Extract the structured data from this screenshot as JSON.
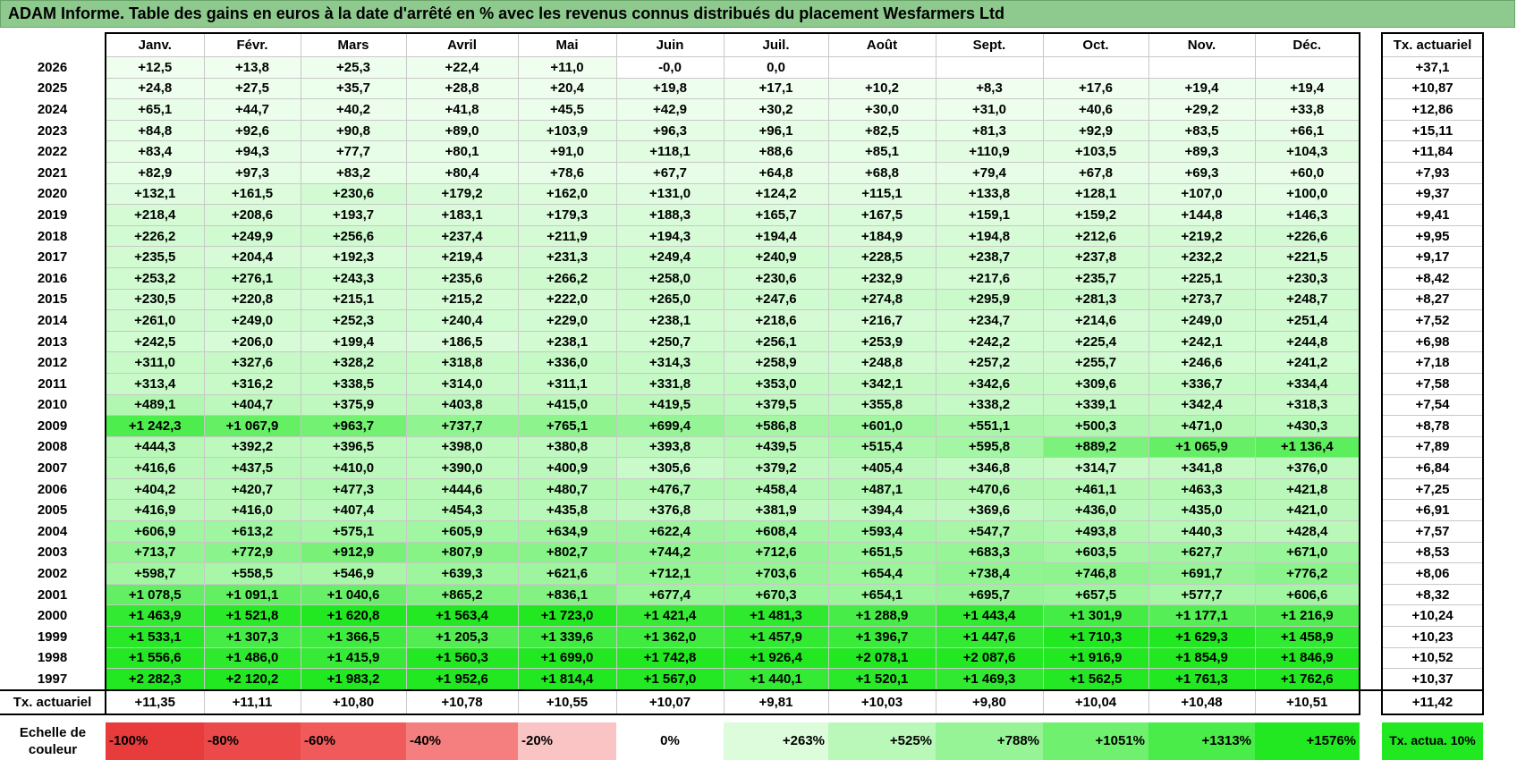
{
  "title": "ADAM Informe. Table des gains en euros à la date d'arrêté en % avec les revenus connus distribués du placement Wesfarmers Ltd",
  "chart_data": {
    "type": "table",
    "columns": [
      "Janv.",
      "Févr.",
      "Mars",
      "Avril",
      "Mai",
      "Juin",
      "Juil.",
      "Août",
      "Sept.",
      "Oct.",
      "Nov.",
      "Déc."
    ],
    "actuarial_header": "Tx. actuariel",
    "rows": [
      {
        "year": "2026",
        "values": [
          "+12,5",
          "+13,8",
          "+25,3",
          "+22,4",
          "+11,0",
          "-0,0",
          "0,0",
          "",
          "",
          "",
          "",
          ""
        ],
        "levels": [
          12.5,
          13.8,
          25.3,
          22.4,
          11.0,
          0,
          0,
          null,
          null,
          null,
          null,
          null
        ],
        "rate": "+37,1"
      },
      {
        "year": "2025",
        "values": [
          "+24,8",
          "+27,5",
          "+35,7",
          "+28,8",
          "+20,4",
          "+19,8",
          "+17,1",
          "+10,2",
          "+8,3",
          "+17,6",
          "+19,4",
          "+19,4"
        ],
        "levels": [
          24.8,
          27.5,
          35.7,
          28.8,
          20.4,
          19.8,
          17.1,
          10.2,
          8.3,
          17.6,
          19.4,
          19.4
        ],
        "rate": "+10,87"
      },
      {
        "year": "2024",
        "values": [
          "+65,1",
          "+44,7",
          "+40,2",
          "+41,8",
          "+45,5",
          "+42,9",
          "+30,2",
          "+30,0",
          "+31,0",
          "+40,6",
          "+29,2",
          "+33,8"
        ],
        "levels": [
          65.1,
          44.7,
          40.2,
          41.8,
          45.5,
          42.9,
          30.2,
          30.0,
          31.0,
          40.6,
          29.2,
          33.8
        ],
        "rate": "+12,86"
      },
      {
        "year": "2023",
        "values": [
          "+84,8",
          "+92,6",
          "+90,8",
          "+89,0",
          "+103,9",
          "+96,3",
          "+96,1",
          "+82,5",
          "+81,3",
          "+92,9",
          "+83,5",
          "+66,1"
        ],
        "levels": [
          84.8,
          92.6,
          90.8,
          89.0,
          103.9,
          96.3,
          96.1,
          82.5,
          81.3,
          92.9,
          83.5,
          66.1
        ],
        "rate": "+15,11"
      },
      {
        "year": "2022",
        "values": [
          "+83,4",
          "+94,3",
          "+77,7",
          "+80,1",
          "+91,0",
          "+118,1",
          "+88,6",
          "+85,1",
          "+110,9",
          "+103,5",
          "+89,3",
          "+104,3"
        ],
        "levels": [
          83.4,
          94.3,
          77.7,
          80.1,
          91.0,
          118.1,
          88.6,
          85.1,
          110.9,
          103.5,
          89.3,
          104.3
        ],
        "rate": "+11,84"
      },
      {
        "year": "2021",
        "values": [
          "+82,9",
          "+97,3",
          "+83,2",
          "+80,4",
          "+78,6",
          "+67,7",
          "+64,8",
          "+68,8",
          "+79,4",
          "+67,8",
          "+69,3",
          "+60,0"
        ],
        "levels": [
          82.9,
          97.3,
          83.2,
          80.4,
          78.6,
          67.7,
          64.8,
          68.8,
          79.4,
          67.8,
          69.3,
          60.0
        ],
        "rate": "+7,93"
      },
      {
        "year": "2020",
        "values": [
          "+132,1",
          "+161,5",
          "+230,6",
          "+179,2",
          "+162,0",
          "+131,0",
          "+124,2",
          "+115,1",
          "+133,8",
          "+128,1",
          "+107,0",
          "+100,0"
        ],
        "levels": [
          132.1,
          161.5,
          230.6,
          179.2,
          162.0,
          131.0,
          124.2,
          115.1,
          133.8,
          128.1,
          107.0,
          100.0
        ],
        "rate": "+9,37"
      },
      {
        "year": "2019",
        "values": [
          "+218,4",
          "+208,6",
          "+193,7",
          "+183,1",
          "+179,3",
          "+188,3",
          "+165,7",
          "+167,5",
          "+159,1",
          "+159,2",
          "+144,8",
          "+146,3"
        ],
        "levels": [
          218.4,
          208.6,
          193.7,
          183.1,
          179.3,
          188.3,
          165.7,
          167.5,
          159.1,
          159.2,
          144.8,
          146.3
        ],
        "rate": "+9,41"
      },
      {
        "year": "2018",
        "values": [
          "+226,2",
          "+249,9",
          "+256,6",
          "+237,4",
          "+211,9",
          "+194,3",
          "+194,4",
          "+184,9",
          "+194,8",
          "+212,6",
          "+219,2",
          "+226,6"
        ],
        "levels": [
          226.2,
          249.9,
          256.6,
          237.4,
          211.9,
          194.3,
          194.4,
          184.9,
          194.8,
          212.6,
          219.2,
          226.6
        ],
        "rate": "+9,95"
      },
      {
        "year": "2017",
        "values": [
          "+235,5",
          "+204,4",
          "+192,3",
          "+219,4",
          "+231,3",
          "+249,4",
          "+240,9",
          "+228,5",
          "+238,7",
          "+237,8",
          "+232,2",
          "+221,5"
        ],
        "levels": [
          235.5,
          204.4,
          192.3,
          219.4,
          231.3,
          249.4,
          240.9,
          228.5,
          238.7,
          237.8,
          232.2,
          221.5
        ],
        "rate": "+9,17"
      },
      {
        "year": "2016",
        "values": [
          "+253,2",
          "+276,1",
          "+243,3",
          "+235,6",
          "+266,2",
          "+258,0",
          "+230,6",
          "+232,9",
          "+217,6",
          "+235,7",
          "+225,1",
          "+230,3"
        ],
        "levels": [
          253.2,
          276.1,
          243.3,
          235.6,
          266.2,
          258.0,
          230.6,
          232.9,
          217.6,
          235.7,
          225.1,
          230.3
        ],
        "rate": "+8,42"
      },
      {
        "year": "2015",
        "values": [
          "+230,5",
          "+220,8",
          "+215,1",
          "+215,2",
          "+222,0",
          "+265,0",
          "+247,6",
          "+274,8",
          "+295,9",
          "+281,3",
          "+273,7",
          "+248,7"
        ],
        "levels": [
          230.5,
          220.8,
          215.1,
          215.2,
          222.0,
          265.0,
          247.6,
          274.8,
          295.9,
          281.3,
          273.7,
          248.7
        ],
        "rate": "+8,27"
      },
      {
        "year": "2014",
        "values": [
          "+261,0",
          "+249,0",
          "+252,3",
          "+240,4",
          "+229,0",
          "+238,1",
          "+218,6",
          "+216,7",
          "+234,7",
          "+214,6",
          "+249,0",
          "+251,4"
        ],
        "levels": [
          261.0,
          249.0,
          252.3,
          240.4,
          229.0,
          238.1,
          218.6,
          216.7,
          234.7,
          214.6,
          249.0,
          251.4
        ],
        "rate": "+7,52"
      },
      {
        "year": "2013",
        "values": [
          "+242,5",
          "+206,0",
          "+199,4",
          "+186,5",
          "+238,1",
          "+250,7",
          "+256,1",
          "+253,9",
          "+242,2",
          "+225,4",
          "+242,1",
          "+244,8"
        ],
        "levels": [
          242.5,
          206.0,
          199.4,
          186.5,
          238.1,
          250.7,
          256.1,
          253.9,
          242.2,
          225.4,
          242.1,
          244.8
        ],
        "rate": "+6,98"
      },
      {
        "year": "2012",
        "values": [
          "+311,0",
          "+327,6",
          "+328,2",
          "+318,8",
          "+336,0",
          "+314,3",
          "+258,9",
          "+248,8",
          "+257,2",
          "+255,7",
          "+246,6",
          "+241,2"
        ],
        "levels": [
          311.0,
          327.6,
          328.2,
          318.8,
          336.0,
          314.3,
          258.9,
          248.8,
          257.2,
          255.7,
          246.6,
          241.2
        ],
        "rate": "+7,18"
      },
      {
        "year": "2011",
        "values": [
          "+313,4",
          "+316,2",
          "+338,5",
          "+314,0",
          "+311,1",
          "+331,8",
          "+353,0",
          "+342,1",
          "+342,6",
          "+309,6",
          "+336,7",
          "+334,4"
        ],
        "levels": [
          313.4,
          316.2,
          338.5,
          314.0,
          311.1,
          331.8,
          353.0,
          342.1,
          342.6,
          309.6,
          336.7,
          334.4
        ],
        "rate": "+7,58"
      },
      {
        "year": "2010",
        "values": [
          "+489,1",
          "+404,7",
          "+375,9",
          "+403,8",
          "+415,0",
          "+419,5",
          "+379,5",
          "+355,8",
          "+338,2",
          "+339,1",
          "+342,4",
          "+318,3"
        ],
        "levels": [
          489.1,
          404.7,
          375.9,
          403.8,
          415.0,
          419.5,
          379.5,
          355.8,
          338.2,
          339.1,
          342.4,
          318.3
        ],
        "rate": "+7,54"
      },
      {
        "year": "2009",
        "values": [
          "+1 242,3",
          "+1 067,9",
          "+963,7",
          "+737,7",
          "+765,1",
          "+699,4",
          "+586,8",
          "+601,0",
          "+551,1",
          "+500,3",
          "+471,0",
          "+430,3"
        ],
        "levels": [
          1242.3,
          1067.9,
          963.7,
          737.7,
          765.1,
          699.4,
          586.8,
          601.0,
          551.1,
          500.3,
          471.0,
          430.3
        ],
        "rate": "+8,78"
      },
      {
        "year": "2008",
        "values": [
          "+444,3",
          "+392,2",
          "+396,5",
          "+398,0",
          "+380,8",
          "+393,8",
          "+439,5",
          "+515,4",
          "+595,8",
          "+889,2",
          "+1 065,9",
          "+1 136,4"
        ],
        "levels": [
          444.3,
          392.2,
          396.5,
          398.0,
          380.8,
          393.8,
          439.5,
          515.4,
          595.8,
          889.2,
          1065.9,
          1136.4
        ],
        "rate": "+7,89"
      },
      {
        "year": "2007",
        "values": [
          "+416,6",
          "+437,5",
          "+410,0",
          "+390,0",
          "+400,9",
          "+305,6",
          "+379,2",
          "+405,4",
          "+346,8",
          "+314,7",
          "+341,8",
          "+376,0"
        ],
        "levels": [
          416.6,
          437.5,
          410.0,
          390.0,
          400.9,
          305.6,
          379.2,
          405.4,
          346.8,
          314.7,
          341.8,
          376.0
        ],
        "rate": "+6,84"
      },
      {
        "year": "2006",
        "values": [
          "+404,2",
          "+420,7",
          "+477,3",
          "+444,6",
          "+480,7",
          "+476,7",
          "+458,4",
          "+487,1",
          "+470,6",
          "+461,1",
          "+463,3",
          "+421,8"
        ],
        "levels": [
          404.2,
          420.7,
          477.3,
          444.6,
          480.7,
          476.7,
          458.4,
          487.1,
          470.6,
          461.1,
          463.3,
          421.8
        ],
        "rate": "+7,25"
      },
      {
        "year": "2005",
        "values": [
          "+416,9",
          "+416,0",
          "+407,4",
          "+454,3",
          "+435,8",
          "+376,8",
          "+381,9",
          "+394,4",
          "+369,6",
          "+436,0",
          "+435,0",
          "+421,0"
        ],
        "levels": [
          416.9,
          416.0,
          407.4,
          454.3,
          435.8,
          376.8,
          381.9,
          394.4,
          369.6,
          436.0,
          435.0,
          421.0
        ],
        "rate": "+6,91"
      },
      {
        "year": "2004",
        "values": [
          "+606,9",
          "+613,2",
          "+575,1",
          "+605,9",
          "+634,9",
          "+622,4",
          "+608,4",
          "+593,4",
          "+547,7",
          "+493,8",
          "+440,3",
          "+428,4"
        ],
        "levels": [
          606.9,
          613.2,
          575.1,
          605.9,
          634.9,
          622.4,
          608.4,
          593.4,
          547.7,
          493.8,
          440.3,
          428.4
        ],
        "rate": "+7,57"
      },
      {
        "year": "2003",
        "values": [
          "+713,7",
          "+772,9",
          "+912,9",
          "+807,9",
          "+802,7",
          "+744,2",
          "+712,6",
          "+651,5",
          "+683,3",
          "+603,5",
          "+627,7",
          "+671,0"
        ],
        "levels": [
          713.7,
          772.9,
          912.9,
          807.9,
          802.7,
          744.2,
          712.6,
          651.5,
          683.3,
          603.5,
          627.7,
          671.0
        ],
        "rate": "+8,53"
      },
      {
        "year": "2002",
        "values": [
          "+598,7",
          "+558,5",
          "+546,9",
          "+639,3",
          "+621,6",
          "+712,1",
          "+703,6",
          "+654,4",
          "+738,4",
          "+746,8",
          "+691,7",
          "+776,2"
        ],
        "levels": [
          598.7,
          558.5,
          546.9,
          639.3,
          621.6,
          712.1,
          703.6,
          654.4,
          738.4,
          746.8,
          691.7,
          776.2
        ],
        "rate": "+8,06"
      },
      {
        "year": "2001",
        "values": [
          "+1 078,5",
          "+1 091,1",
          "+1 040,6",
          "+865,2",
          "+836,1",
          "+677,4",
          "+670,3",
          "+654,1",
          "+695,7",
          "+657,5",
          "+577,7",
          "+606,6"
        ],
        "levels": [
          1078.5,
          1091.1,
          1040.6,
          865.2,
          836.1,
          677.4,
          670.3,
          654.1,
          695.7,
          657.5,
          577.7,
          606.6
        ],
        "rate": "+8,32"
      },
      {
        "year": "2000",
        "values": [
          "+1 463,9",
          "+1 521,8",
          "+1 620,8",
          "+1 563,4",
          "+1 723,0",
          "+1 421,4",
          "+1 481,3",
          "+1 288,9",
          "+1 443,4",
          "+1 301,9",
          "+1 177,1",
          "+1 216,9"
        ],
        "levels": [
          1463.9,
          1521.8,
          1620.8,
          1563.4,
          1723.0,
          1421.4,
          1481.3,
          1288.9,
          1443.4,
          1301.9,
          1177.1,
          1216.9
        ],
        "rate": "+10,24"
      },
      {
        "year": "1999",
        "values": [
          "+1 533,1",
          "+1 307,3",
          "+1 366,5",
          "+1 205,3",
          "+1 339,6",
          "+1 362,0",
          "+1 457,9",
          "+1 396,7",
          "+1 447,6",
          "+1 710,3",
          "+1 629,3",
          "+1 458,9"
        ],
        "levels": [
          1533.1,
          1307.3,
          1366.5,
          1205.3,
          1339.6,
          1362.0,
          1457.9,
          1396.7,
          1447.6,
          1710.3,
          1629.3,
          1458.9
        ],
        "rate": "+10,23"
      },
      {
        "year": "1998",
        "values": [
          "+1 556,6",
          "+1 486,0",
          "+1 415,9",
          "+1 560,3",
          "+1 699,0",
          "+1 742,8",
          "+1 926,4",
          "+2 078,1",
          "+2 087,6",
          "+1 916,9",
          "+1 854,9",
          "+1 846,9"
        ],
        "levels": [
          1556.6,
          1486.0,
          1415.9,
          1560.3,
          1699.0,
          1742.8,
          1926.4,
          2078.1,
          2087.6,
          1916.9,
          1854.9,
          1846.9
        ],
        "rate": "+10,52"
      },
      {
        "year": "1997",
        "values": [
          "+2 282,3",
          "+2 120,2",
          "+1 983,2",
          "+1 952,6",
          "+1 814,4",
          "+1 567,0",
          "+1 440,1",
          "+1 520,1",
          "+1 469,3",
          "+1 562,5",
          "+1 761,3",
          "+1 762,6"
        ],
        "levels": [
          2282.3,
          2120.2,
          1983.2,
          1952.6,
          1814.4,
          1567.0,
          1440.1,
          1520.1,
          1469.3,
          1562.5,
          1761.3,
          1762.6
        ],
        "rate": "+10,37"
      }
    ],
    "totals": {
      "label": "Tx. actuariel",
      "values": [
        "+11,35",
        "+11,11",
        "+10,80",
        "+10,78",
        "+10,55",
        "+10,07",
        "+9,81",
        "+10,03",
        "+9,80",
        "+10,04",
        "+10,48",
        "+10,51"
      ],
      "overall": "+11,42"
    },
    "scale": {
      "label": "Echelle de couleur",
      "items": [
        {
          "text": "-100%",
          "color": "#e83c3c",
          "align": "left"
        },
        {
          "text": "-80%",
          "color": "#ec4a4a",
          "align": "left"
        },
        {
          "text": "-60%",
          "color": "#f05a5a",
          "align": "left"
        },
        {
          "text": "-40%",
          "color": "#f57f7f",
          "align": "left"
        },
        {
          "text": "-20%",
          "color": "#fbc4c4",
          "align": "left"
        },
        {
          "text": "0%",
          "color": "#ffffff",
          "align": "center"
        },
        {
          "text": "+263%",
          "color": "#dcfcdc",
          "align": "right"
        },
        {
          "text": "+525%",
          "color": "#b9f8b9",
          "align": "right"
        },
        {
          "text": "+788%",
          "color": "#96f496",
          "align": "right"
        },
        {
          "text": "+1051%",
          "color": "#6ff06f",
          "align": "right"
        },
        {
          "text": "+1313%",
          "color": "#49ec49",
          "align": "right"
        },
        {
          "text": "+1576%",
          "color": "#22e822",
          "align": "right"
        }
      ],
      "ref_label": "Tx. actua. 10%",
      "ref_color": "#22e822"
    }
  }
}
